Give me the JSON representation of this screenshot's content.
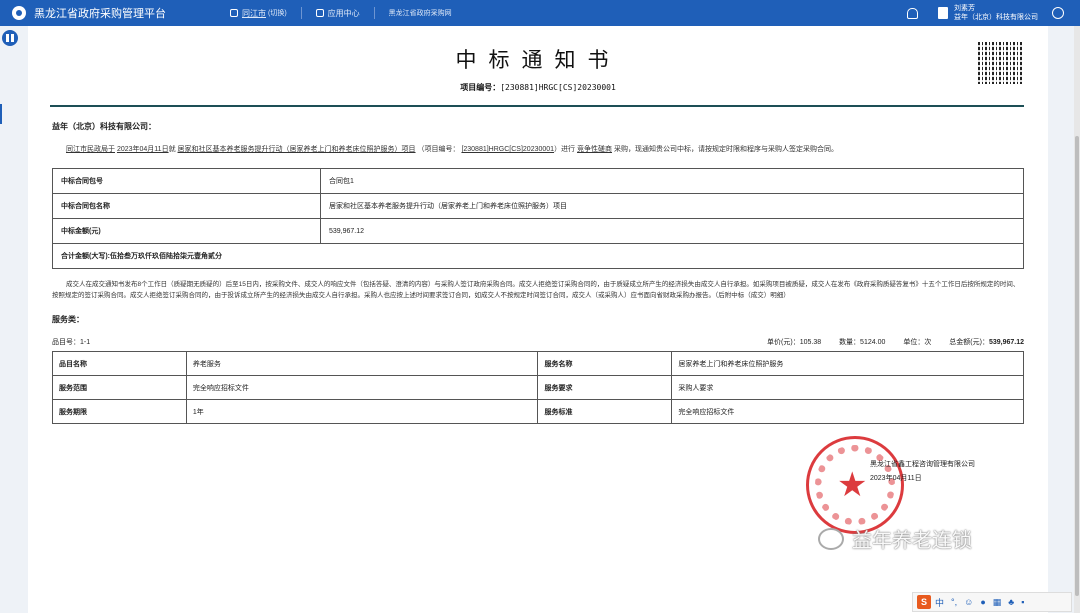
{
  "header": {
    "app_title": "黑龙江省政府采购管理平台",
    "region": "同江市",
    "region_sub": "(切换)",
    "app_center": "应用中心",
    "gov_site": "黑龙江省政府采购网",
    "user_name": "刘素芳",
    "user_org": "益年（北京）科技有限公司"
  },
  "notice": {
    "title": "中标通知书",
    "project_no_label": "项目编号：",
    "project_no": "[230881]HRGC[CS]20230001",
    "addressee": "益年（北京）科技有限公司：",
    "intro_a": "同江市民政局于",
    "intro_date": "2023年04月11日",
    "intro_b": "就",
    "intro_project": "居家和社区基本养老服务提升行动（居家养老上门和养老床位照护服务）项目",
    "intro_c": "（项目编号：",
    "intro_no": "[230881]HRGC[CS]20230001",
    "intro_d": "）进行",
    "intro_method": "竞争性磋商",
    "intro_e": "采购，现通知贵公司中标，请按规定时限和程序与采购人签定采购合同。"
  },
  "award_table": {
    "rows": [
      {
        "label": "中标合同包号",
        "value": "合同包1"
      },
      {
        "label": "中标合同包名称",
        "value": "居家和社区基本养老服务提升行动（居家养老上门和养老床位照护服务）项目"
      },
      {
        "label": "中标金额(元)",
        "value": "539,967.12"
      },
      {
        "label": "合计金额(大写):伍拾叁万玖仟玖佰陆拾柒元壹角贰分",
        "value": ""
      }
    ]
  },
  "terms": "成交人在成交通知书发布8个工作日（质疑期无质疑的）后至15日内，按采购文件、成交人的响应文件（包括答疑、澄清的内容）与采购人签订政府采购合同。成交人拒绝签订采购合同的，由于质疑成立所产生的经济损失由成交人自行承担。如采购项目被质疑，成交人在发布《政府采购质疑答复书》十五个工作日后按所规定的时间、按照规定的签订采购合同。成交人拒绝签订采购合同的，由于投诉成立所产生的经济损失由成交人自行承担。采购人也应按上述时间要求签订合同，如成交人不按规定时间签订合同，成交人（或采购人）应书面向省财政采购办报告。（后附中标（成交）明细）",
  "service": {
    "section_label": "服务类：",
    "item_no": "品目号：1-1",
    "unit_price": "单价(元)：105.38",
    "quantity": "数量：5124.00",
    "unit": "单位：次",
    "total_label": "总金额(元)：",
    "total": "539,967.12",
    "rows": [
      [
        "品目名称",
        "养老服务",
        "服务名称",
        "居家养老上门和养老床位照护服务"
      ],
      [
        "服务范围",
        "完全响应招标文件",
        "服务要求",
        "采购人要求"
      ],
      [
        "服务期限",
        "1年",
        "服务标准",
        "完全响应招标文件"
      ]
    ]
  },
  "signature": {
    "org": "黑龙江省鑫工程咨询管理有限公司",
    "date": "2023年04月11日"
  },
  "watermark": "益年养老连锁",
  "ime": {
    "logo": "S",
    "mode": "中"
  }
}
